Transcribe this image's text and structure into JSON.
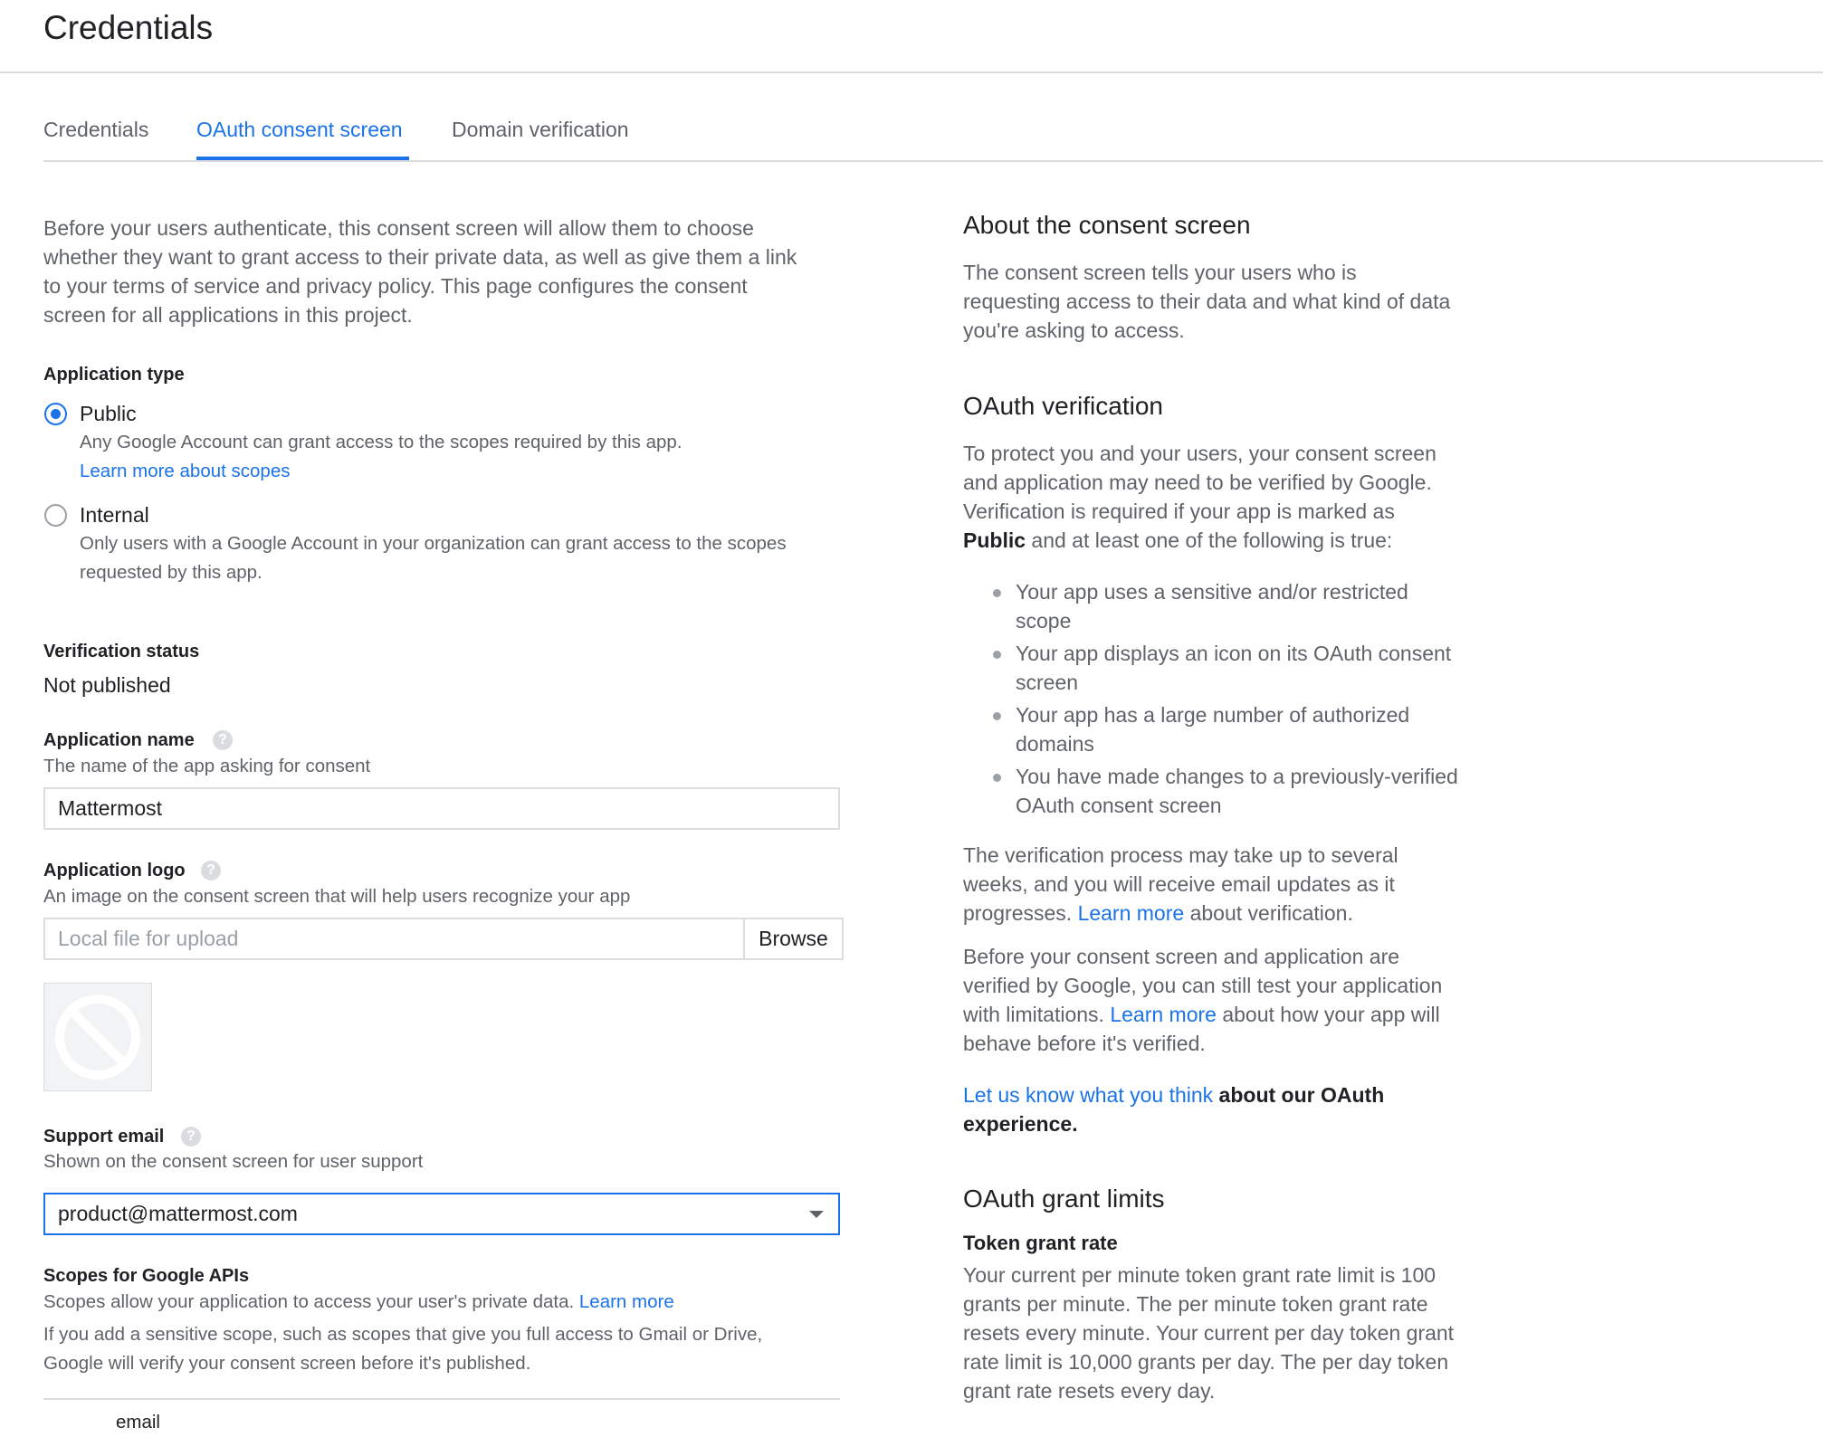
{
  "header": {
    "title": "Credentials"
  },
  "tabs": [
    {
      "label": "Credentials",
      "active": false
    },
    {
      "label": "OAuth consent screen",
      "active": true
    },
    {
      "label": "Domain verification",
      "active": false
    }
  ],
  "left": {
    "intro": [
      "Before your users authenticate, this consent screen will allow them to choose",
      "whether they want to grant access to their private data, as well as give them a link",
      "to your terms of service and privacy policy. This page configures the consent",
      "screen for all applications in this project."
    ],
    "app_type": {
      "label": "Application type",
      "public": {
        "label": "Public",
        "desc": "Any Google Account can grant access to the scopes required by this app.",
        "link": "Learn more about scopes",
        "selected": true
      },
      "internal": {
        "label": "Internal",
        "desc": [
          "Only users with a Google Account in your organization can grant access to the scopes",
          "requested by this app."
        ],
        "selected": false
      }
    },
    "verification": {
      "label": "Verification status",
      "value": "Not published"
    },
    "app_name": {
      "label": "Application name",
      "desc": "The name of the app asking for consent",
      "value": "Mattermost"
    },
    "app_logo": {
      "label": "Application logo",
      "desc": "An image on the consent screen that will help users recognize your app",
      "placeholder": "Local file for upload",
      "browse": "Browse"
    },
    "support_email": {
      "label": "Support email",
      "desc": "Shown on the consent screen for user support",
      "value": "product@mattermost.com"
    },
    "scopes": {
      "label": "Scopes for Google APIs",
      "desc": "Scopes allow your application to access your user's private data.",
      "desc_link": "Learn more",
      "note": [
        "If you add a sensitive scope, such as scopes that give you full access to Gmail or Drive,",
        "Google will verify your consent screen before it's published."
      ],
      "first_scope": "email"
    }
  },
  "right": {
    "about": {
      "title": "About the consent screen",
      "body": [
        "The consent screen tells your users who is",
        "requesting access to their data and what kind of data",
        "you're asking to access."
      ]
    },
    "oauth_verification": {
      "title": "OAuth verification",
      "body_lines": [
        "To protect you and your users, your consent screen",
        "and application may need to be verified by Google.",
        "Verification is required if your app is marked as"
      ],
      "public_word": "Public",
      "body_tail": " and at least one of the following is true:",
      "bullets": [
        [
          "Your app uses a sensitive and/or restricted",
          "scope"
        ],
        [
          "Your app displays an icon on its OAuth consent",
          "screen"
        ],
        [
          "Your app has a large number of authorized",
          "domains"
        ],
        [
          "You have made changes to a previously-verified",
          "OAuth consent screen"
        ]
      ],
      "process_lines": [
        "The verification process may take up to several",
        "weeks, and you will receive email updates as it"
      ],
      "process_prefix": "progresses.",
      "process_link": "Learn more",
      "process_suffix": " about verification.",
      "before_lines": [
        "Before your consent screen and application are",
        "verified by Google, you can still test your application"
      ],
      "before_prefix": "with limitations.",
      "before_link": "Learn more",
      "before_suffix": " about how your app will",
      "before_last": "behave before it's verified.",
      "feedback_link": "Let us know what you think",
      "feedback_suffix": " about our OAuth",
      "feedback_last": "experience."
    },
    "grant_limits": {
      "title": "OAuth grant limits",
      "subtitle": "Token grant rate",
      "body": [
        "Your current per minute token grant rate limit is 100",
        "grants per minute. The per minute token grant rate",
        "resets every minute. Your current per day token grant",
        "rate limit is 10,000 grants per day. The per day token",
        "grant rate resets every day."
      ]
    }
  },
  "colors": {
    "accent": "#1a73e8",
    "text": "#202124",
    "secondary": "#5f6368",
    "border": "#dadce0"
  },
  "icons": {
    "help": "help-circle-icon",
    "no_image": "no-image-icon",
    "dropdown": "dropdown-arrow-icon"
  }
}
